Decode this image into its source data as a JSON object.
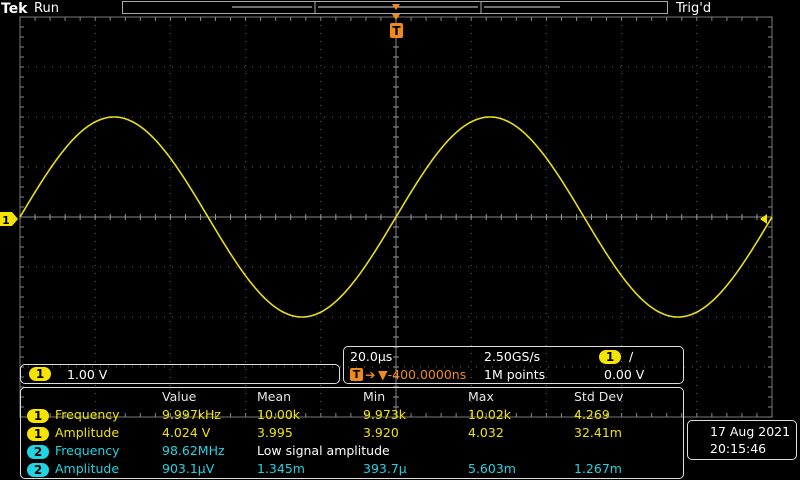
{
  "header": {
    "brand": "Tek",
    "status": "Run",
    "trigger_state": "Trig'd",
    "trigger_marker": "T"
  },
  "channel_marker": "1",
  "channel_panel": {
    "channel": "1",
    "scale": "1.00 V"
  },
  "timebase": {
    "horizontal_scale": "20.0µs",
    "sample_rate": "2.50GS/s",
    "trigger_channel": "1",
    "trigger_slope": "∕",
    "trigger_position": "▼-400.0000ns",
    "record_length": "1M points",
    "trigger_level": "0.00 V"
  },
  "measurements": {
    "headers": [
      "Value",
      "Mean",
      "Min",
      "Max",
      "Std Dev"
    ],
    "rows": [
      {
        "channel": "1",
        "color": "#f5e400",
        "name": "Frequency",
        "value": "9.997kHz",
        "mean": "10.00k",
        "min": "9.973k",
        "max": "10.02k",
        "std": "4.269"
      },
      {
        "channel": "1",
        "color": "#f5e400",
        "name": "Amplitude",
        "value": "4.024 V",
        "mean": "3.995",
        "min": "3.920",
        "max": "4.032",
        "std": "32.41m"
      },
      {
        "channel": "2",
        "color": "#21d4e3",
        "name": "Frequency",
        "value": "98.62MHz",
        "note": "Low signal amplitude"
      },
      {
        "channel": "2",
        "color": "#21d4e3",
        "name": "Amplitude",
        "value": "903.1µV",
        "mean": "1.345m",
        "min": "393.7µ",
        "max": "5.603m",
        "std": "1.267m"
      }
    ]
  },
  "datetime": {
    "date": "17 Aug 2021",
    "time": "20:15:46"
  },
  "waveform": {
    "channel": "1",
    "color": "#e8de1a",
    "frequency_hz": 10000,
    "amplitude_v_pp": 4.0,
    "volts_per_div": 1.0,
    "seconds_per_div": 2e-05
  }
}
